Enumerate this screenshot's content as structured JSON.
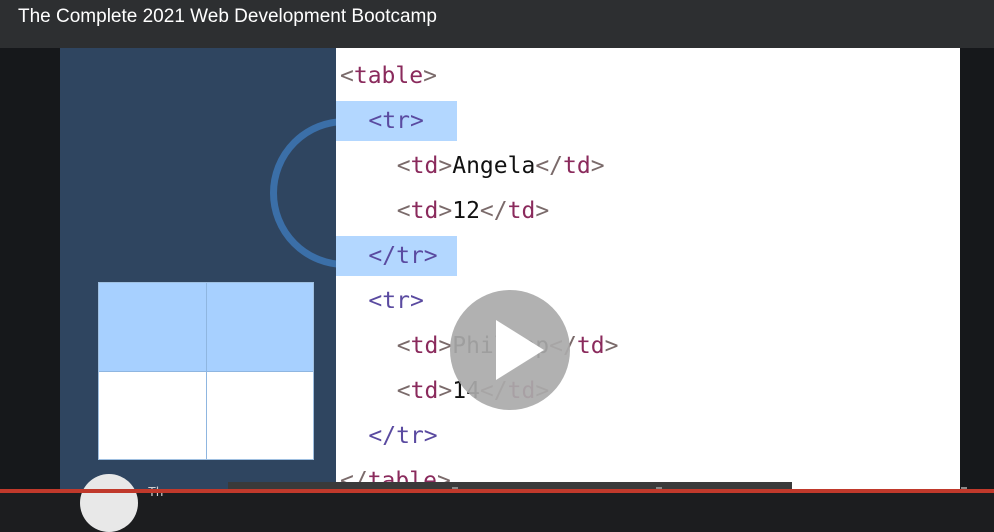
{
  "course": {
    "title": "The Complete 2021 Web Development Bootcamp"
  },
  "video": {
    "code_lines": [
      {
        "indent": "",
        "open": "<",
        "tag": "table",
        "close": ">",
        "content": "",
        "kind": "table"
      },
      {
        "indent": "  ",
        "open": "<",
        "tag": "tr",
        "close": ">",
        "content": "",
        "kind": "tr"
      },
      {
        "indent": "    ",
        "open": "<",
        "tag": "td",
        "close": ">",
        "content": "Angela</td>",
        "kind": "td"
      },
      {
        "indent": "    ",
        "open": "<",
        "tag": "td",
        "close": ">",
        "content": "12</td>",
        "kind": "td"
      },
      {
        "indent": "  ",
        "open": "</",
        "tag": "tr",
        "close": ">",
        "content": "",
        "kind": "tr"
      },
      {
        "indent": "  ",
        "open": "<",
        "tag": "tr",
        "close": ">",
        "content": "",
        "kind": "tr"
      },
      {
        "indent": "    ",
        "open": "<",
        "tag": "td",
        "close": ">",
        "content": "Philipp</td>",
        "kind": "td"
      },
      {
        "indent": "    ",
        "open": "<",
        "tag": "td",
        "close": ">",
        "content": "14</td>",
        "kind": "td"
      },
      {
        "indent": "  ",
        "open": "</",
        "tag": "tr",
        "close": ">",
        "content": "",
        "kind": "tr"
      },
      {
        "indent": "",
        "open": "</",
        "tag": "table",
        "close": ">",
        "content": "",
        "kind": "table"
      }
    ],
    "highlighted_lines": [
      1,
      4
    ],
    "colors": {
      "highlight": "#b3d7ff",
      "tag_tr": "#5a4aa0",
      "tag_td": "#8a2a5c",
      "video_bg": "#2f4560"
    }
  },
  "overlay_icons": {
    "play": "play-icon"
  },
  "footer": {
    "instructor_name_fragment": "Th"
  }
}
